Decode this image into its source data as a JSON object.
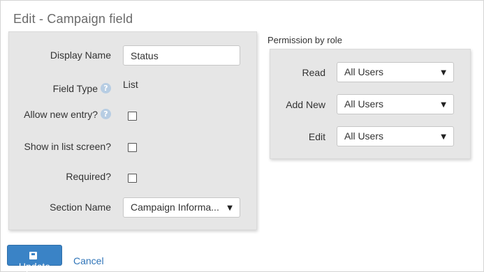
{
  "page": {
    "title": "Edit - Campaign field"
  },
  "fields": {
    "display_name": {
      "label": "Display Name",
      "value": "Status"
    },
    "field_type": {
      "label": "Field Type",
      "value": "List",
      "help": "?"
    },
    "allow_new_entry": {
      "label": "Allow new entry?",
      "checked": false,
      "help": "?"
    },
    "show_in_list": {
      "label": "Show in list screen?",
      "checked": false
    },
    "required": {
      "label": "Required?",
      "checked": false
    },
    "section_name": {
      "label": "Section Name",
      "value": "Campaign Informa...",
      "caret": "▼"
    }
  },
  "permissions": {
    "title": "Permission by role",
    "read": {
      "label": "Read",
      "value": "All Users",
      "caret": "▼"
    },
    "add_new": {
      "label": "Add New",
      "value": "All Users",
      "caret": "▼"
    },
    "edit": {
      "label": "Edit",
      "value": "All Users",
      "caret": "▼"
    }
  },
  "actions": {
    "update": "Update",
    "cancel": "Cancel"
  }
}
